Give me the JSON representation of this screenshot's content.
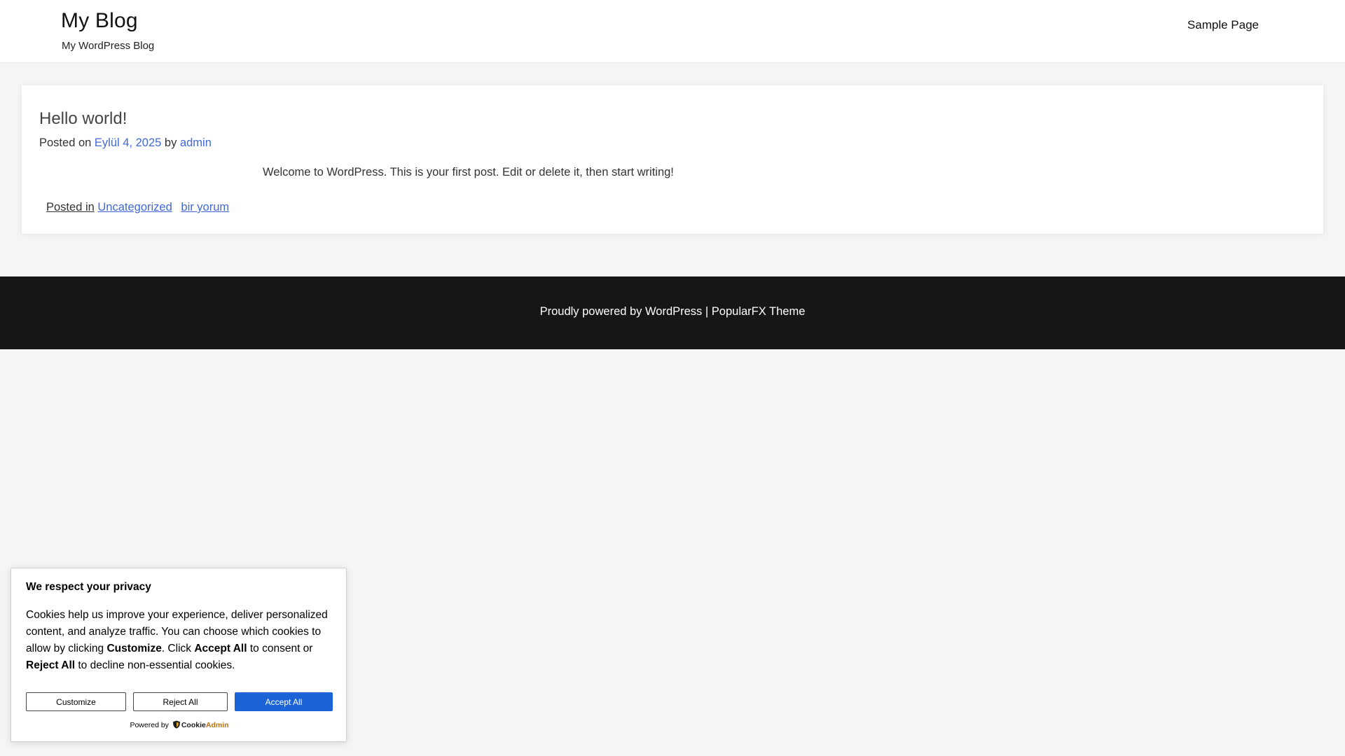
{
  "header": {
    "site_title": "My Blog",
    "site_description": "My WordPress Blog",
    "nav": [
      {
        "label": "Sample Page"
      }
    ]
  },
  "post": {
    "title": "Hello world!",
    "meta": {
      "posted_on_label": "Posted on",
      "date": "Eylül 4, 2025",
      "by_label": "by",
      "author": "admin"
    },
    "content": "Welcome to WordPress. This is your first post. Edit or delete it, then start writing!",
    "footer": {
      "posted_in_label": "Posted in",
      "category": "Uncategorized",
      "comment_link": "bir yorum"
    }
  },
  "footer": {
    "credit_wp": "Proudly powered by WordPress",
    "separator": "|",
    "credit_theme": "PopularFX Theme"
  },
  "cookie": {
    "title": "We respect your privacy",
    "text_1": "Cookies help us improve your experience, deliver personalized content, and analyze traffic. You can choose which cookies to allow by clicking ",
    "customize_bold": "Customize",
    "text_2": ". Click ",
    "accept_bold": "Accept All",
    "text_3": " to consent or ",
    "reject_bold": "Reject All",
    "text_4": " to decline non-essential cookies.",
    "buttons": {
      "customize": "Customize",
      "reject": "Reject All",
      "accept": "Accept All"
    },
    "powered_by": "Powered by",
    "brand_part1": "Cookie",
    "brand_part2": "Admin",
    "brand_icon": "shield-icon",
    "accent_color": "#1d63d8"
  }
}
